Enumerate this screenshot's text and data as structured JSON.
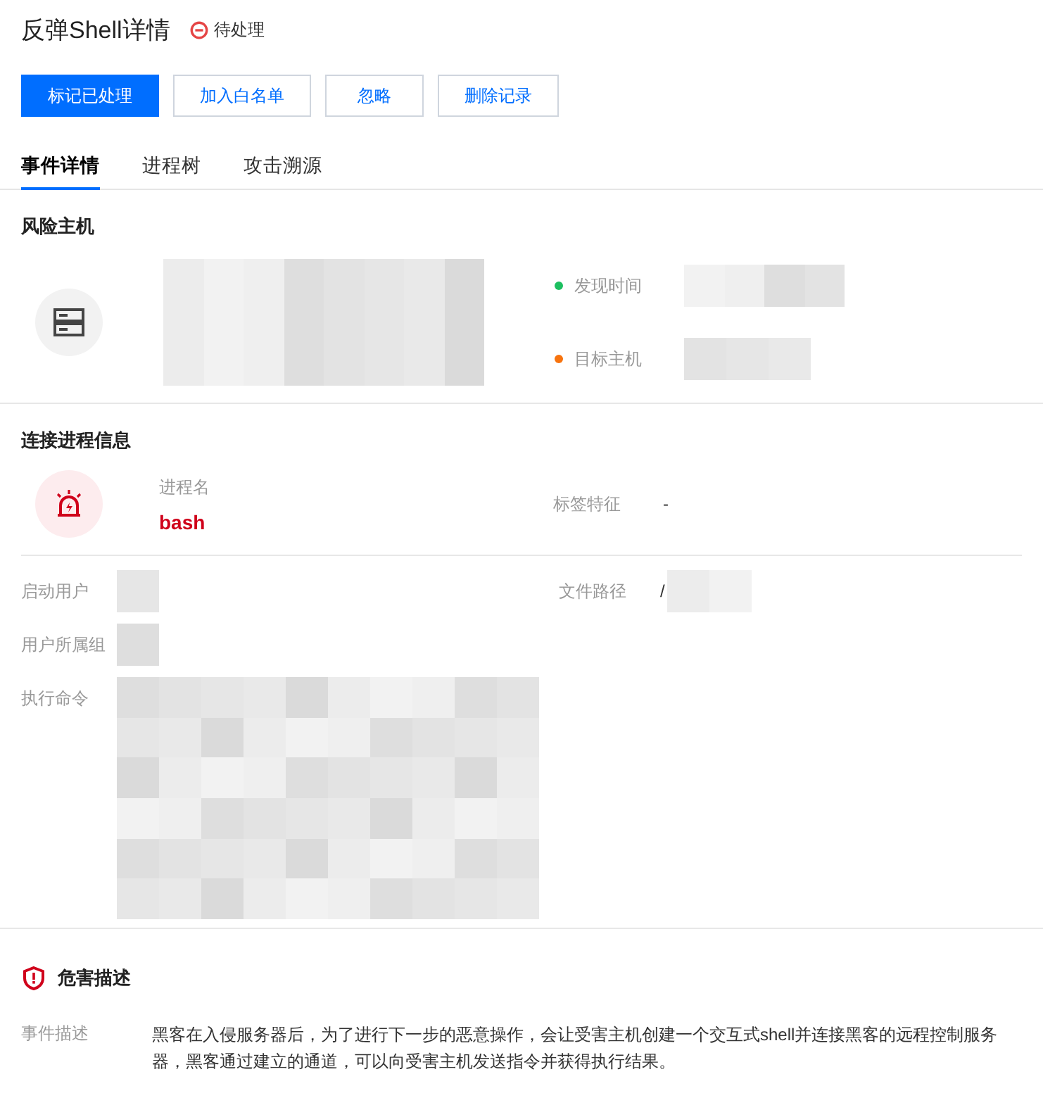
{
  "header": {
    "title": "反弹Shell详情",
    "status": "待处理"
  },
  "actions": [
    {
      "label": "标记已处理",
      "primary": true
    },
    {
      "label": "加入白名单",
      "primary": false
    },
    {
      "label": "忽略",
      "primary": false
    },
    {
      "label": "删除记录",
      "primary": false
    }
  ],
  "tabs": [
    {
      "label": "事件详情",
      "selected": true
    },
    {
      "label": "进程树",
      "selected": false
    },
    {
      "label": "攻击溯源",
      "selected": false
    }
  ],
  "host": {
    "title": "风险主机",
    "fields": [
      {
        "label": "发现时间",
        "color": "#1dbf60"
      },
      {
        "label": "目标主机",
        "color": "#f7730e"
      }
    ]
  },
  "process": {
    "title": "连接进程信息",
    "name_label": "进程名",
    "name": "bash",
    "tag_label": "标签特征",
    "tag": "-",
    "fields": [
      {
        "label": "启动用户"
      },
      {
        "label": "文件路径",
        "value": "/"
      },
      {
        "label": "用户所属组"
      },
      {
        "label": "执行命令"
      }
    ]
  },
  "harm": {
    "title": "危害描述",
    "label": "事件描述",
    "text": "黑客在入侵服务器后，为了进行下一步的恶意操作，会让受害主机创建一个交互式shell并连接黑客的远程控制服务器，黑客通过建立的通道，可以向受害主机发送指令并获得执行结果。"
  }
}
